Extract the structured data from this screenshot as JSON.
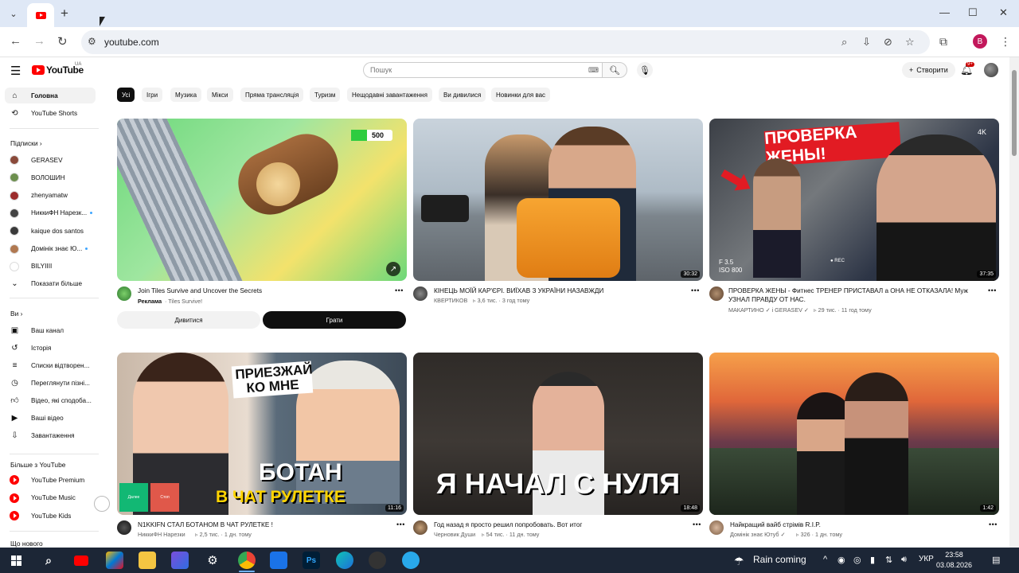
{
  "browser": {
    "url": "youtube.com",
    "new_tab": "+",
    "win_min": "—",
    "win_max": "☐",
    "win_close": "✕",
    "profile_initial": "B"
  },
  "header": {
    "logo_text": "YouTube",
    "logo_country": "UA",
    "search_placeholder": "Пошук",
    "create_label": "Створити",
    "notif_count": "9+"
  },
  "sidebar": {
    "main": [
      {
        "label": "Головна",
        "icon": "home-icon"
      },
      {
        "label": "YouTube Shorts",
        "icon": "shorts-icon"
      }
    ],
    "subs_heading": "Підписки",
    "subscriptions": [
      {
        "label": "GERASEV",
        "color": "#8a4a3a",
        "new": false
      },
      {
        "label": "ВОЛОШИН",
        "color": "#6d8f4e",
        "new": false
      },
      {
        "label": "zhenyamatw",
        "color": "#9c2c2c",
        "new": false
      },
      {
        "label": "НиккиФН Нарезк...",
        "color": "#444444",
        "new": true
      },
      {
        "label": "kaique dos santos",
        "color": "#3a3a3a",
        "new": false
      },
      {
        "label": "Домінік знає Ю...",
        "color": "#b07850",
        "new": true
      },
      {
        "label": "BILYIIII",
        "color": "#ffffff",
        "new": false
      }
    ],
    "show_more": "Показати більше",
    "you_heading": "Ви",
    "you_items": [
      {
        "label": "Ваш канал",
        "icon": "channel-icon"
      },
      {
        "label": "Історія",
        "icon": "history-icon"
      },
      {
        "label": "Списки відтворен...",
        "icon": "playlists-icon"
      },
      {
        "label": "Переглянути пізні...",
        "icon": "watch-later-icon"
      },
      {
        "label": "Відео, які сподоба...",
        "icon": "liked-icon"
      },
      {
        "label": "Ваші відео",
        "icon": "your-videos-icon"
      },
      {
        "label": "Завантаження",
        "icon": "downloads-icon"
      }
    ],
    "more_heading": "Більше з YouTube",
    "more_items": [
      {
        "label": "YouTube Premium"
      },
      {
        "label": "YouTube Music"
      },
      {
        "label": "YouTube Kids"
      }
    ],
    "bottom_heading": "Що нового"
  },
  "chips": [
    "Усі",
    "Ігри",
    "Музика",
    "Мікси",
    "Пряма трансляція",
    "Туризм",
    "Нещодавні завантаження",
    "Ви дивилися",
    "Новинки для вас"
  ],
  "videos": [
    {
      "title": "Join Tiles Survive and Uncover the Secrets",
      "channel": "Реклама",
      "meta": "· Tiles Survive!",
      "badge": "500",
      "ad": true,
      "btn_watch": "Дивитися",
      "btn_play": "Грати"
    },
    {
      "title": "КІНЕЦЬ МОЇЙ КАР'ЄРІ. ВИЇХАВ З УКРАЇНИ НАЗАВЖДИ",
      "channel": "КВЕРТИКОВ",
      "meta": "3,6 тис. · 3 год тому",
      "duration": "30:32"
    },
    {
      "title": "ПРОВЕРКА ЖЕНЫ - Фитнес ТРЕНЕР ПРИСТАВАЛ а ОНА НЕ ОТКАЗАЛА! Муж УЗНАЛ ПРАВДУ ОТ НАС.",
      "channel": "МАКАРТИНО ✓ і GERASEV ✓",
      "meta": "29 тис. · 11 год тому",
      "duration": "37:35",
      "overlay": "ПРОВЕРКА ЖЕНЫ!",
      "corner": "4K",
      "cam_f": "F 3.5",
      "cam_iso": "ISO 800",
      "cam_rec": "● REC"
    },
    {
      "title": "N1KKIFN СТАЛ БОТАНОМ В ЧАТ РУЛЕТКЕ !",
      "channel": "НиккиФН Нарезки",
      "meta": "2,5 тис. · 1 дн. тому",
      "duration": "11:16",
      "overlay_top": "ПРИЕЗЖАЙ КО МНЕ",
      "overlay_big": "БОТАН",
      "overlay_sub": "В ЧАТ РУЛЕТКЕ",
      "btn_a": "Далее",
      "btn_b": "Стоп"
    },
    {
      "title": "Год назад я просто решил попробовать. Вот итог",
      "channel": "Черновик Души",
      "meta": "54 тис. · 11 дн. тому",
      "duration": "18:48",
      "overlay": "Я НАЧАЛ С НУЛЯ"
    },
    {
      "title": "Найкращий вайб стрімів R.I.P.",
      "channel": "Домінік знає Ютуб ✓",
      "meta": "326 · 1 дн. тому",
      "duration": "1:42"
    }
  ],
  "taskbar": {
    "weather": "Rain coming",
    "lang": "УКР",
    "time": "23:58",
    "date": "03.08.2026"
  }
}
